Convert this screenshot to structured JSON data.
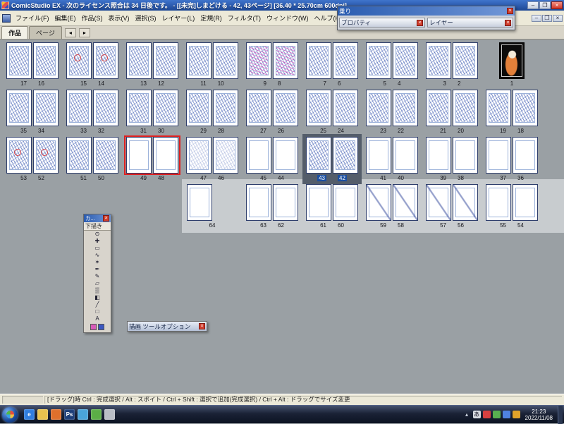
{
  "window": {
    "title": "ComicStudio EX - 次のライセンス照合は 34 日後です。 - [[未完]しまどける - 42, 43ページ] [36.40 * 25.70cm 600dpi]",
    "controls": {
      "minimize": "–",
      "maximize": "❐",
      "close": "×"
    }
  },
  "menu": {
    "items": [
      "ファイル(F)",
      "編集(E)",
      "作品(S)",
      "表示(V)",
      "選択(S)",
      "レイヤー(L)",
      "定規(R)",
      "フィルタ(T)",
      "ウィンドウ(W)",
      "ヘルプ(H)"
    ]
  },
  "document_window": {
    "controls": {
      "minimize": "–",
      "restore": "❐",
      "close": "×"
    }
  },
  "toolbar": {
    "buttons": [
      {
        "name": "new-page-icon",
        "glyph": "▤"
      },
      {
        "name": "page-list-icon",
        "glyph": "▥"
      },
      {
        "name": "thumbnail-view-icon",
        "glyph": "▦"
      },
      {
        "name": "spread-view-icon",
        "glyph": "◫"
      },
      {
        "name": "page-settings-icon",
        "glyph": "▧"
      },
      {
        "name": "grid-view-icon",
        "glyph": "⊞"
      }
    ]
  },
  "tabs": {
    "work": "作品",
    "page": "ページ",
    "nav_prev": "◂",
    "nav_next": "▸"
  },
  "palettes": {
    "close_glyph": "×",
    "float_top": {
      "title": "乗り"
    },
    "properties": {
      "title": "プロパティ"
    },
    "layers": {
      "title": "レイヤー"
    },
    "toolbox": {
      "title": "カ...",
      "layer_label": "下描き",
      "tools": [
        {
          "name": "zoom-tool-icon",
          "glyph": "⊙"
        },
        {
          "name": "hand-tool-icon",
          "glyph": "✚"
        },
        {
          "name": "marquee-select-tool-icon",
          "glyph": "▭"
        },
        {
          "name": "lasso-select-tool-icon",
          "glyph": "∿"
        },
        {
          "name": "magic-wand-tool-icon",
          "glyph": "✶"
        },
        {
          "name": "pen-tool-icon",
          "glyph": "✒"
        },
        {
          "name": "pencil-tool-icon",
          "glyph": "✎"
        },
        {
          "name": "eraser-tool-icon",
          "glyph": "▱"
        },
        {
          "name": "airbrush-tool-icon",
          "glyph": "▒"
        },
        {
          "name": "fill-tool-icon",
          "glyph": "◧"
        },
        {
          "name": "line-tool-icon",
          "glyph": "╱"
        },
        {
          "name": "shape-tool-icon",
          "glyph": "□"
        },
        {
          "name": "text-tool-icon",
          "glyph": "A"
        }
      ],
      "colors": {
        "foreground": "#d85cb8",
        "background": "#3a56c0"
      }
    },
    "tool_options": {
      "title": "描画 ツールオプション"
    }
  },
  "pages": {
    "rows": [
      {
        "offset": 0,
        "items": [
          {
            "t": "spread",
            "l": "17",
            "r": "16",
            "sk": true
          },
          {
            "t": "spread",
            "l": "15",
            "r": "14",
            "sk": true,
            "rm": true
          },
          {
            "t": "spread",
            "l": "13",
            "r": "12",
            "sk": true
          },
          {
            "t": "spread",
            "l": "11",
            "r": "10",
            "sk": true
          },
          {
            "t": "spread",
            "l": "9",
            "r": "8",
            "sk": true,
            "pink": true
          },
          {
            "t": "spread",
            "l": "7",
            "r": "6",
            "sk": true
          },
          {
            "t": "spread",
            "l": "5",
            "r": "4",
            "sk": true
          },
          {
            "t": "spread",
            "l": "3",
            "r": "2",
            "sk": true
          },
          {
            "t": "cover",
            "l": "1"
          }
        ]
      },
      {
        "offset": 0,
        "items": [
          {
            "t": "spread",
            "l": "35",
            "r": "34",
            "sk": true
          },
          {
            "t": "spread",
            "l": "33",
            "r": "32",
            "sk": true
          },
          {
            "t": "spread",
            "l": "31",
            "r": "30",
            "sk": true
          },
          {
            "t": "spread",
            "l": "29",
            "r": "28",
            "sk": true
          },
          {
            "t": "spread",
            "l": "27",
            "r": "26",
            "sk": true
          },
          {
            "t": "spread",
            "l": "25",
            "r": "24",
            "sk": true
          },
          {
            "t": "spread",
            "l": "23",
            "r": "22",
            "sk": true
          },
          {
            "t": "spread",
            "l": "21",
            "r": "20",
            "sk": true
          },
          {
            "t": "spread",
            "l": "19",
            "r": "18",
            "sk": true
          }
        ]
      },
      {
        "offset": 0,
        "items": [
          {
            "t": "spread",
            "l": "53",
            "r": "52",
            "sk": true,
            "rm": true
          },
          {
            "t": "spread",
            "l": "51",
            "r": "50",
            "sk": true
          },
          {
            "t": "spread",
            "l": "49",
            "r": "48",
            "red": true
          },
          {
            "t": "spread",
            "l": "47",
            "r": "46",
            "sk": true,
            "lt": true
          },
          {
            "t": "spread",
            "l": "45",
            "r": "44"
          },
          {
            "t": "spread",
            "l": "43",
            "r": "42",
            "sk": true,
            "sel": true
          },
          {
            "t": "spread",
            "l": "41",
            "r": "40"
          },
          {
            "t": "spread",
            "l": "39",
            "r": "38"
          },
          {
            "t": "spread",
            "l": "37",
            "r": "36"
          }
        ]
      },
      {
        "offset": 3,
        "items": [
          {
            "t": "single",
            "l": "64"
          },
          {
            "t": "spread",
            "l": "63",
            "r": "62"
          },
          {
            "t": "spread",
            "l": "61",
            "r": "60"
          },
          {
            "t": "spread",
            "l": "59",
            "r": "58",
            "cross": true
          },
          {
            "t": "spread",
            "l": "57",
            "r": "56",
            "cross": true
          },
          {
            "t": "spread",
            "l": "55",
            "r": "54"
          }
        ]
      }
    ]
  },
  "statusbar": {
    "hint": "[ドラッグ]時 Ctrl : 完成選択 / Alt : スポイト / Ctrl + Shift : 選択で追加(完成選択) / Ctrl + Alt : ドラッグでサイズ変更"
  },
  "taskbar": {
    "quicklaunch": [
      {
        "name": "internet-explorer-icon",
        "glyph": "e",
        "color": "#2f7de0"
      },
      {
        "name": "folder-icon",
        "glyph": "",
        "color": "#e8c24e"
      },
      {
        "name": "media-player-icon",
        "glyph": "",
        "color": "#e0702c"
      },
      {
        "name": "photoshop-icon",
        "glyph": "Ps",
        "color": "#1c3e78"
      },
      {
        "name": "paint-app-icon",
        "glyph": "",
        "color": "#4aa3d8"
      },
      {
        "name": "app-green-icon",
        "glyph": "",
        "color": "#5bae46"
      },
      {
        "name": "app-gray-icon",
        "glyph": "",
        "color": "#b9bec6"
      }
    ],
    "tray": [
      {
        "name": "hidden-icons-chevron",
        "glyph": "▴",
        "color": "transparent"
      },
      {
        "name": "ime-icon",
        "glyph": "あ",
        "color": "#d8dce2"
      },
      {
        "name": "antivirus-tray-icon",
        "glyph": "",
        "color": "#d84040"
      },
      {
        "name": "network-tray-icon",
        "glyph": "",
        "color": "#58b050"
      },
      {
        "name": "volume-tray-icon",
        "glyph": "",
        "color": "#4f82e0"
      },
      {
        "name": "update-tray-icon",
        "glyph": "",
        "color": "#e0a22a"
      }
    ],
    "clock": {
      "time": "21:23",
      "date": "2022/11/08"
    }
  }
}
